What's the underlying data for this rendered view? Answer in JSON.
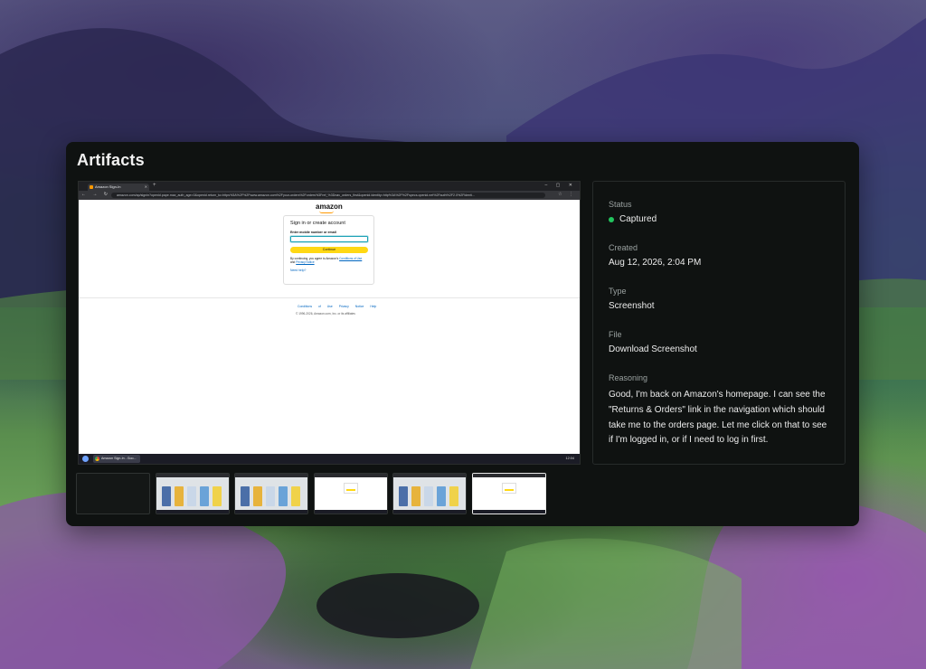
{
  "panel": {
    "title": "Artifacts"
  },
  "screenshot": {
    "tab_title": "Amazon Sign-In",
    "url": "amazon.com/ap/signin?openid.pape.max_auth_age=0&openid.return_to=https%3A%2F%2Fwww.amazon.com%2Fyour-orders%2Forders%3Fref_%3Dnav_orders_first&openid.identity=http%3A%2F%2Fspecs.openid.net%2Fauth%2F2.0%2Fidenti...",
    "logo": "amazon",
    "signin_title": "Sign in or create account",
    "field_label": "Enter mobile number or email",
    "continue_label": "Continue",
    "legal_prefix": "By continuing, you agree to Amazon's",
    "legal_conditions": "Conditions of Use",
    "legal_and": "and",
    "legal_privacy": "Privacy Notice",
    "help_label": "Need help?",
    "footer_links": "Conditions of Use   Privacy Notice   Help",
    "footer_copy": "© 1996-2026, Amazon.com, Inc. or its affiliates",
    "taskbar_app": "Amazon Sign-In - Goo...",
    "taskbar_time": "12:04"
  },
  "details": {
    "status_label": "Status",
    "status_value": "Captured",
    "status_color": "#22c55e",
    "created_label": "Created",
    "created_value": "Aug 12, 2026, 2:04 PM",
    "type_label": "Type",
    "type_value": "Screenshot",
    "file_label": "File",
    "file_value": "Download Screenshot",
    "reasoning_label": "Reasoning",
    "reasoning_value": "Good, I'm back on Amazon's homepage. I can see the \"Returns & Orders\" link in the navigation which should take me to the orders page. Let me click on that to see if I'm logged in, or if I need to log in first."
  },
  "thumbnails": [
    {
      "kind": "blank"
    },
    {
      "kind": "store"
    },
    {
      "kind": "store"
    },
    {
      "kind": "login"
    },
    {
      "kind": "store"
    },
    {
      "kind": "login",
      "selected": true
    }
  ]
}
